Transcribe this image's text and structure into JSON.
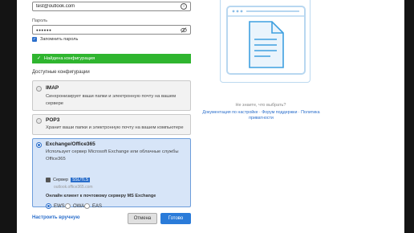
{
  "email": {
    "value": "test@outlook.com"
  },
  "password": {
    "label": "Пароль",
    "value": "●●●●●●"
  },
  "remember": {
    "label": "Запомнить пароль"
  },
  "banner": {
    "text": "Найдена конфигурация",
    "color": "#2fb52f"
  },
  "section_title": "Доступные конфигурации",
  "options": {
    "imap": {
      "title": "IMAP",
      "desc": "Синхронизирует ваши папки и электронную почту на вашем сервере"
    },
    "pop3": {
      "title": "POP3",
      "desc": "Хранит ваши папки и электронную почту на вашем компьютере"
    },
    "exchange": {
      "title": "Exchange/Office365",
      "desc": "Использует сервер Microsoft Exchange или облачные службы Office365",
      "server_label": "Сервер",
      "server_tag": "SSL/TLS",
      "server_host": "outlook.office365.com",
      "online_label": "Онлайн клиент к почтовому серверу MS Exchange",
      "protocols": [
        "EWS",
        "OWA",
        "EAS"
      ],
      "selected_protocol": "EWS"
    }
  },
  "manual_link": "Настроить вручную",
  "buttons": {
    "cancel": "Отмена",
    "ok": "Готово"
  },
  "help": {
    "question": "Не знаете, что выбрать?",
    "links": "Документация по настройке · Форум поддержки · Политика приватности"
  },
  "colors": {
    "accent": "#2a6ecb",
    "success": "#2fb52f",
    "selected_bg": "#d7e5f8"
  }
}
